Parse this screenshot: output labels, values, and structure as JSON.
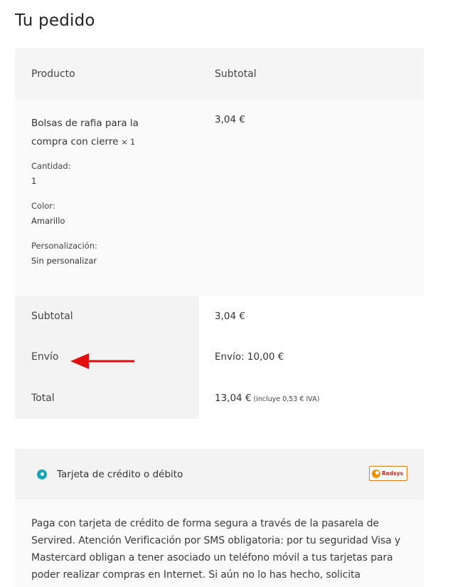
{
  "page": {
    "title": "Tu pedido"
  },
  "table": {
    "headers": {
      "product": "Producto",
      "subtotal": "Subtotal"
    },
    "item": {
      "name": "Bolsas de rafia para la compra con cierre",
      "qty": "× 1",
      "subtotal": "3,04 €",
      "meta": [
        {
          "label": "Cantidad:",
          "value": "1"
        },
        {
          "label": "Color:",
          "value": "Amarillo"
        },
        {
          "label": "Personalización:",
          "value": "Sin personalizar"
        }
      ]
    },
    "totals": {
      "subtotal_label": "Subtotal",
      "subtotal_value": "3,04 €",
      "shipping_label": "Envío",
      "shipping_value": "Envío: 10,00 €",
      "total_label": "Total",
      "total_value": "13,04 €",
      "total_tax_note": "(incluye 0,53 € IVA)"
    }
  },
  "annotation": {
    "arrow_color": "#e10f0f",
    "icon": "arrow-left-icon"
  },
  "payment": {
    "method_label": "Tarjeta de crédito o débito",
    "selected": true,
    "radio_color": "#1aa3b4",
    "logo_text": "Redsys",
    "description": "Paga con tarjeta de crédito de forma segura a través de la pasarela de Servired. Atención Verificación por SMS obligatoria: por tu seguridad Visa y Mastercard obligan a tener asociado un teléfono móvil a tus tarjetas para poder realizar compras en Internet. Si aún no lo has hecho, solicita"
  }
}
